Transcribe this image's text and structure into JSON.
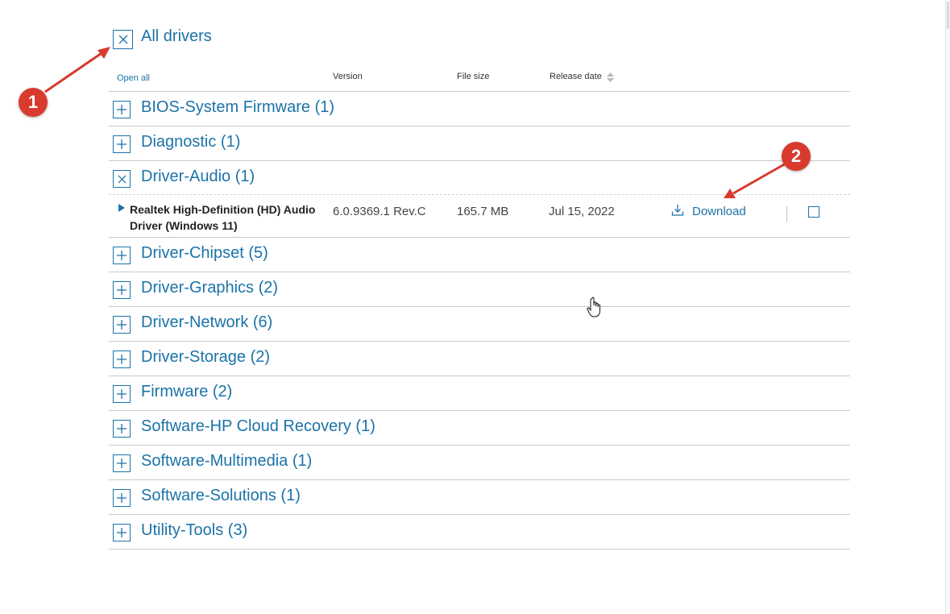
{
  "all_drivers": {
    "label": "All drivers",
    "expanded": true
  },
  "columns": {
    "open_all": "Open all",
    "version": "Version",
    "file_size": "File size",
    "release_date": "Release date"
  },
  "categories": [
    {
      "label": "BIOS-System Firmware (1)",
      "expanded": false
    },
    {
      "label": "Diagnostic (1)",
      "expanded": false
    },
    {
      "label": "Driver-Audio (1)",
      "expanded": true
    },
    {
      "label": "Driver-Chipset (5)",
      "expanded": false
    },
    {
      "label": "Driver-Graphics (2)",
      "expanded": false
    },
    {
      "label": "Driver-Network (6)",
      "expanded": false
    },
    {
      "label": "Driver-Storage (2)",
      "expanded": false
    },
    {
      "label": "Firmware (2)",
      "expanded": false
    },
    {
      "label": "Software-HP Cloud Recovery (1)",
      "expanded": false
    },
    {
      "label": "Software-Multimedia (1)",
      "expanded": false
    },
    {
      "label": "Software-Solutions (1)",
      "expanded": false
    },
    {
      "label": "Utility-Tools (3)",
      "expanded": false
    }
  ],
  "driver": {
    "name_line1": "Realtek High-Definition (HD) Audio",
    "name_line2": "Driver (Windows 11)",
    "version": "6.0.9369.1 Rev.C",
    "file_size": "165.7 MB",
    "release_date": "Jul 15, 2022",
    "download_label": "Download",
    "selected": false
  },
  "annotations": [
    {
      "number": "1"
    },
    {
      "number": "2"
    }
  ],
  "colors": {
    "accent": "#1b73a8",
    "annotation": "#d83a2e"
  }
}
